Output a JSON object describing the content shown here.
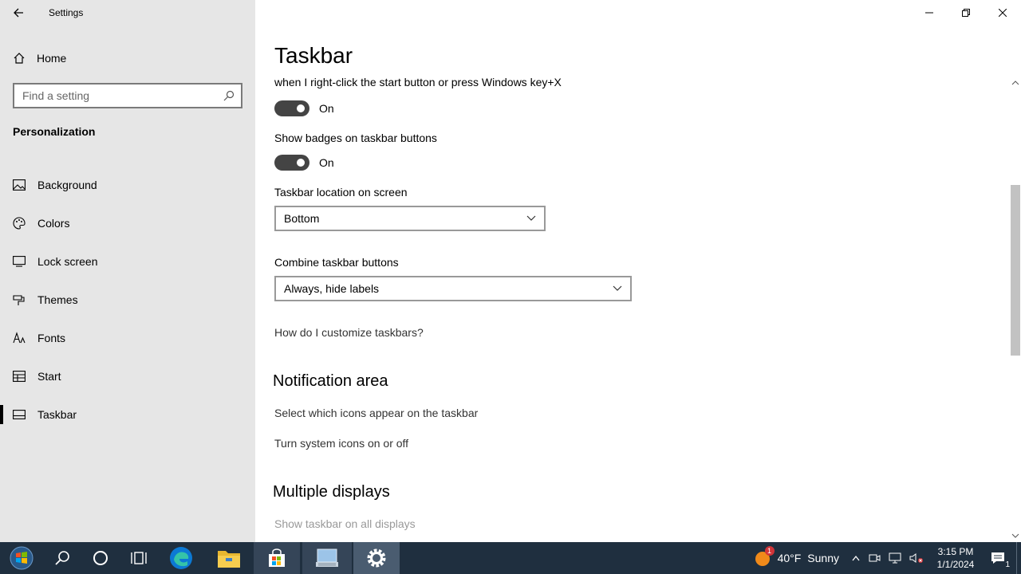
{
  "window": {
    "title": "Settings"
  },
  "sidebar": {
    "home_label": "Home",
    "search_placeholder": "Find a setting",
    "section_title": "Personalization",
    "items": [
      {
        "label": "Background",
        "icon": "picture-icon"
      },
      {
        "label": "Colors",
        "icon": "palette-icon"
      },
      {
        "label": "Lock screen",
        "icon": "lock-screen-icon"
      },
      {
        "label": "Themes",
        "icon": "brush-icon"
      },
      {
        "label": "Fonts",
        "icon": "font-icon"
      },
      {
        "label": "Start",
        "icon": "start-icon"
      },
      {
        "label": "Taskbar",
        "icon": "taskbar-icon",
        "selected": true
      }
    ]
  },
  "main": {
    "page_title": "Taskbar",
    "power_user_menu_text": "when I right-click the start button or press Windows key+X",
    "power_user_toggle_state": "On",
    "badges_label": "Show badges on taskbar buttons",
    "badges_toggle_state": "On",
    "location_label": "Taskbar location on screen",
    "location_value": "Bottom",
    "combine_label": "Combine taskbar buttons",
    "combine_value": "Always, hide labels",
    "help_link": "How do I customize taskbars?",
    "notification_heading": "Notification area",
    "select_icons_link": "Select which icons appear on the taskbar",
    "system_icons_link": "Turn system icons on or off",
    "multiple_displays_heading": "Multiple displays",
    "show_all_displays_label": "Show taskbar on all displays"
  },
  "taskbar": {
    "weather_temp": "40°F",
    "weather_condition": "Sunny",
    "weather_badge": "1",
    "time": "3:15 PM",
    "date": "1/1/2024",
    "notification_count": "1"
  },
  "colors": {
    "taskbar_bg": "#1f2f3f",
    "sidebar_bg": "#e6e6e6",
    "toggle_on": "#444444"
  }
}
